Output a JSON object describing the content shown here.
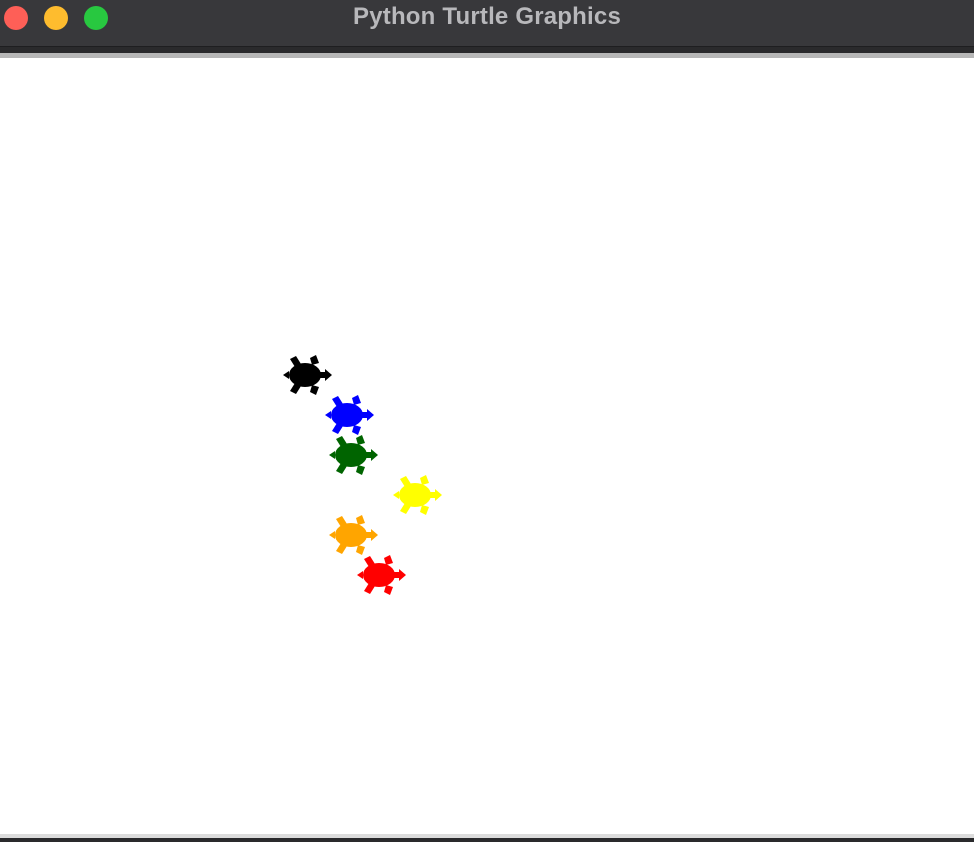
{
  "window": {
    "title": "Python Turtle Graphics",
    "controls": {
      "close_color": "#fe5f57",
      "minimize_color": "#febc2e",
      "maximize_color": "#28c840"
    }
  },
  "canvas": {
    "background": "#ffffff",
    "turtles": [
      {
        "name": "turtle-black",
        "color": "#000000"
      },
      {
        "name": "turtle-blue",
        "color": "#0000ff"
      },
      {
        "name": "turtle-green",
        "color": "#006400"
      },
      {
        "name": "turtle-yellow",
        "color": "#ffff00"
      },
      {
        "name": "turtle-orange",
        "color": "#ffa500"
      },
      {
        "name": "turtle-red",
        "color": "#ff0000"
      }
    ]
  }
}
